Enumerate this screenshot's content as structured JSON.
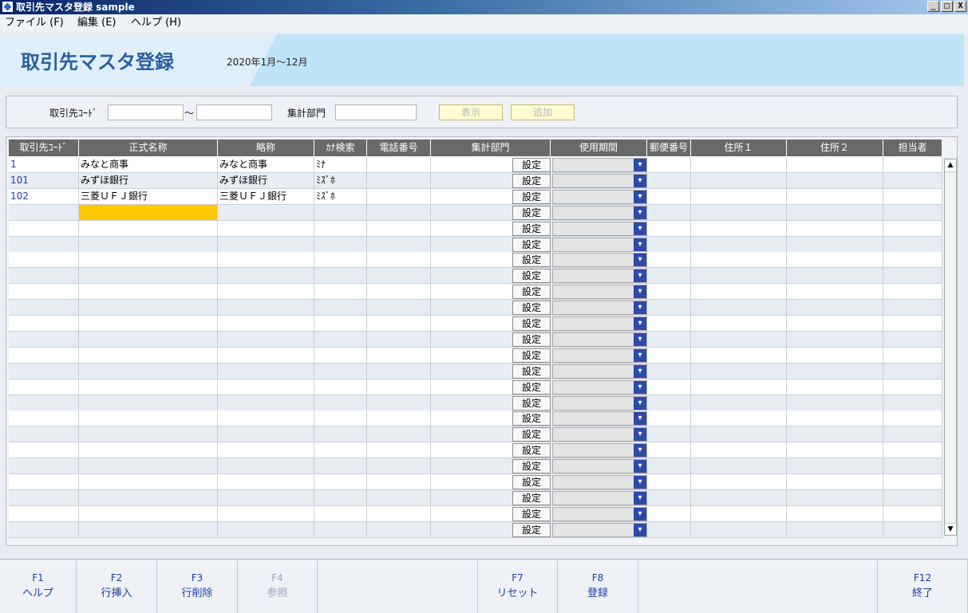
{
  "window": {
    "title": "取引先マスタ登録 sample",
    "min": "_",
    "max": "□",
    "close": "X"
  },
  "menu": [
    "ファイル (F)",
    "編集 (E)",
    "ヘルプ (H)"
  ],
  "header": {
    "title": "取引先マスタ登録",
    "period": "2020年1月～12月"
  },
  "search": {
    "code_label": "取引先ｺｰﾄﾞ",
    "tilde": "～",
    "dept_label": "集計部門",
    "show_button": "表示",
    "add_button": "追加",
    "code_from": "",
    "code_to": "",
    "dept": ""
  },
  "grid": {
    "columns": [
      "取引先ｺｰﾄﾞ",
      "正式名称",
      "略称",
      "ｶﾅ検索",
      "電話番号",
      "集計部門",
      "使用期間",
      "郵便番号",
      "住所１",
      "住所２",
      "担当者"
    ],
    "set_label": "設定",
    "dropdown_icon": "chevron-down-icon",
    "selected_row": 3,
    "selected_color": "#ffc800",
    "rows": [
      [
        "1",
        "みなと商事",
        "みなと商事",
        "ﾐﾅ",
        "",
        "",
        "",
        "",
        "",
        "",
        ""
      ],
      [
        "101",
        "みずほ銀行",
        "みずほ銀行",
        "ﾐｽﾞﾎ",
        "",
        "",
        "",
        "",
        "",
        "",
        ""
      ],
      [
        "102",
        "三菱ＵＦＪ銀行",
        "三菱ＵＦＪ銀行",
        "ﾐｽﾞﾎ",
        "",
        "",
        "",
        "",
        "",
        "",
        ""
      ],
      [
        "",
        "",
        "",
        "",
        "",
        "",
        "",
        "",
        "",
        "",
        ""
      ],
      [
        "",
        "",
        "",
        "",
        "",
        "",
        "",
        "",
        "",
        "",
        ""
      ],
      [
        "",
        "",
        "",
        "",
        "",
        "",
        "",
        "",
        "",
        "",
        ""
      ],
      [
        "",
        "",
        "",
        "",
        "",
        "",
        "",
        "",
        "",
        "",
        ""
      ],
      [
        "",
        "",
        "",
        "",
        "",
        "",
        "",
        "",
        "",
        "",
        ""
      ],
      [
        "",
        "",
        "",
        "",
        "",
        "",
        "",
        "",
        "",
        "",
        ""
      ],
      [
        "",
        "",
        "",
        "",
        "",
        "",
        "",
        "",
        "",
        "",
        ""
      ],
      [
        "",
        "",
        "",
        "",
        "",
        "",
        "",
        "",
        "",
        "",
        ""
      ],
      [
        "",
        "",
        "",
        "",
        "",
        "",
        "",
        "",
        "",
        "",
        ""
      ],
      [
        "",
        "",
        "",
        "",
        "",
        "",
        "",
        "",
        "",
        "",
        ""
      ],
      [
        "",
        "",
        "",
        "",
        "",
        "",
        "",
        "",
        "",
        "",
        ""
      ],
      [
        "",
        "",
        "",
        "",
        "",
        "",
        "",
        "",
        "",
        "",
        ""
      ],
      [
        "",
        "",
        "",
        "",
        "",
        "",
        "",
        "",
        "",
        "",
        ""
      ],
      [
        "",
        "",
        "",
        "",
        "",
        "",
        "",
        "",
        "",
        "",
        ""
      ],
      [
        "",
        "",
        "",
        "",
        "",
        "",
        "",
        "",
        "",
        "",
        ""
      ],
      [
        "",
        "",
        "",
        "",
        "",
        "",
        "",
        "",
        "",
        "",
        ""
      ],
      [
        "",
        "",
        "",
        "",
        "",
        "",
        "",
        "",
        "",
        "",
        ""
      ],
      [
        "",
        "",
        "",
        "",
        "",
        "",
        "",
        "",
        "",
        "",
        ""
      ],
      [
        "",
        "",
        "",
        "",
        "",
        "",
        "",
        "",
        "",
        "",
        ""
      ],
      [
        "",
        "",
        "",
        "",
        "",
        "",
        "",
        "",
        "",
        "",
        ""
      ],
      [
        "",
        "",
        "",
        "",
        "",
        "",
        "",
        "",
        "",
        "",
        ""
      ]
    ]
  },
  "fkeys": [
    {
      "key": "F1",
      "label": "ヘルプ",
      "enabled": true
    },
    {
      "key": "F2",
      "label": "行挿入",
      "enabled": true
    },
    {
      "key": "F3",
      "label": "行削除",
      "enabled": true
    },
    {
      "key": "F4",
      "label": "参照",
      "enabled": false
    },
    {
      "key": "",
      "label": "",
      "enabled": false
    },
    {
      "key": "",
      "label": "",
      "enabled": false
    },
    {
      "key": "F7",
      "label": "リセット",
      "enabled": true
    },
    {
      "key": "F8",
      "label": "登録",
      "enabled": true
    },
    {
      "key": "",
      "label": "",
      "enabled": false
    },
    {
      "key": "",
      "label": "",
      "enabled": false
    },
    {
      "key": "",
      "label": "",
      "enabled": false
    },
    {
      "key": "F12",
      "label": "終了",
      "enabled": true
    }
  ]
}
